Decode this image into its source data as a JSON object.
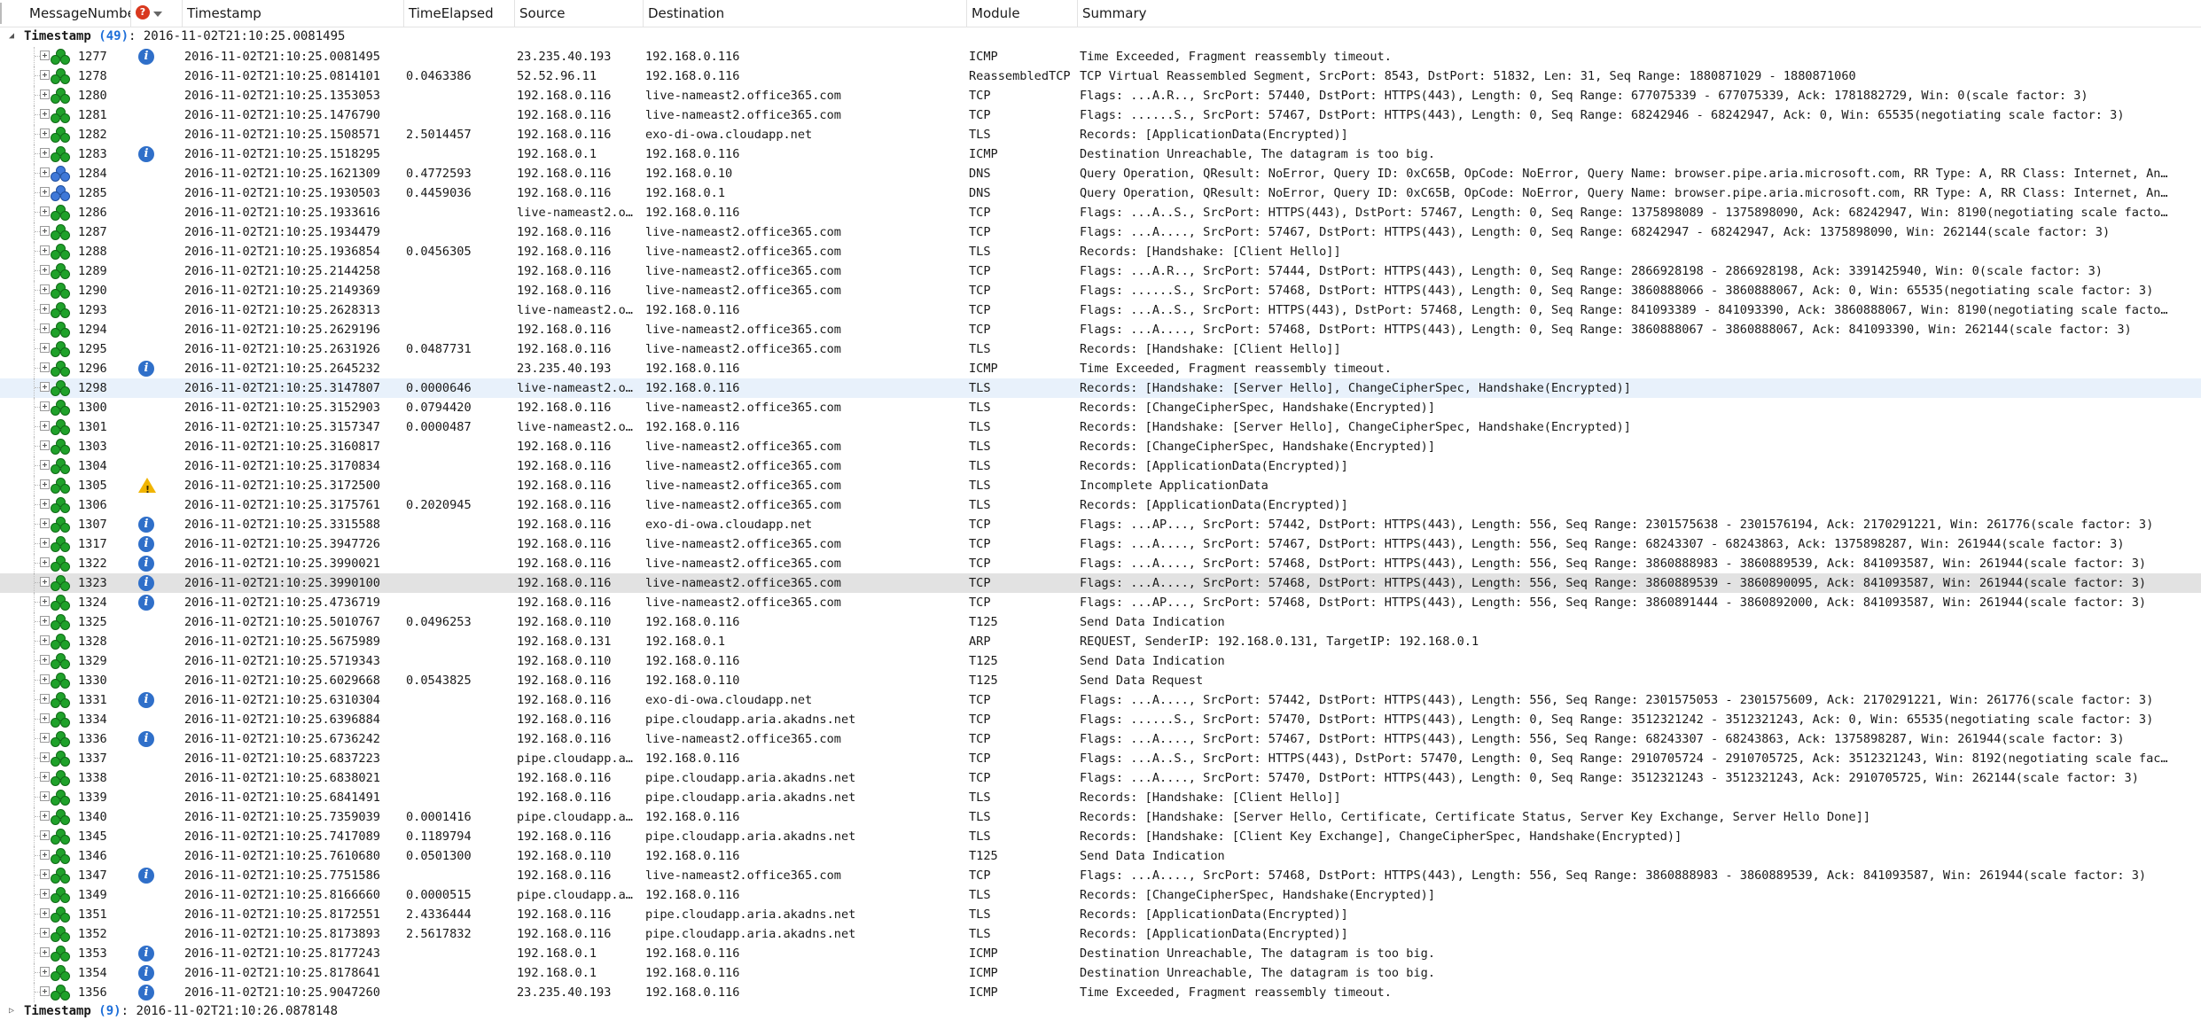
{
  "columns": {
    "message_number": "MessageNumber",
    "timestamp": "Timestamp",
    "time_elapsed": "TimeElapsed",
    "source": "Source",
    "destination": "Destination",
    "module": "Module",
    "summary": "Summary"
  },
  "groups": [
    {
      "label": "Timestamp",
      "count": "(49)",
      "value": ": 2016-11-02T21:10:25.0081495",
      "expanded": true
    },
    {
      "label": "Timestamp",
      "count": "(9)",
      "value": ": 2016-11-02T21:10:26.0878148",
      "expanded": false
    }
  ],
  "rows": [
    {
      "num": "1277",
      "ts": "2016-11-02T21:10:25.0081495",
      "el": "",
      "src": "23.235.40.193",
      "dst": "192.168.0.116",
      "mod": "ICMP",
      "sum": "Time Exceeded, Fragment reassembly timeout.",
      "icon": "green",
      "diag": "info"
    },
    {
      "num": "1278",
      "ts": "2016-11-02T21:10:25.0814101",
      "el": "0.0463386",
      "src": "52.52.96.11",
      "dst": "192.168.0.116",
      "mod": "ReassembledTCP",
      "sum": "TCP Virtual Reassembled Segment, SrcPort: 8543, DstPort: 51832, Len: 31, Seq Range: 1880871029 - 1880871060",
      "icon": "green",
      "diag": ""
    },
    {
      "num": "1280",
      "ts": "2016-11-02T21:10:25.1353053",
      "el": "",
      "src": "192.168.0.116",
      "dst": "live-nameast2.office365.com",
      "mod": "TCP",
      "sum": "Flags: ...A.R.., SrcPort: 57440, DstPort: HTTPS(443), Length: 0, Seq Range: 677075339 - 677075339, Ack: 1781882729, Win: 0(scale factor: 3)",
      "icon": "green",
      "diag": ""
    },
    {
      "num": "1281",
      "ts": "2016-11-02T21:10:25.1476790",
      "el": "",
      "src": "192.168.0.116",
      "dst": "live-nameast2.office365.com",
      "mod": "TCP",
      "sum": "Flags: ......S., SrcPort: 57467, DstPort: HTTPS(443), Length: 0, Seq Range: 68242946 - 68242947, Ack: 0, Win: 65535(negotiating scale factor: 3)",
      "icon": "green",
      "diag": ""
    },
    {
      "num": "1282",
      "ts": "2016-11-02T21:10:25.1508571",
      "el": "2.5014457",
      "src": "192.168.0.116",
      "dst": "exo-di-owa.cloudapp.net",
      "mod": "TLS",
      "sum": "Records: [ApplicationData(Encrypted)]",
      "icon": "green",
      "diag": ""
    },
    {
      "num": "1283",
      "ts": "2016-11-02T21:10:25.1518295",
      "el": "",
      "src": "192.168.0.1",
      "dst": "192.168.0.116",
      "mod": "ICMP",
      "sum": "Destination Unreachable, The datagram is too big.",
      "icon": "green",
      "diag": "info"
    },
    {
      "num": "1284",
      "ts": "2016-11-02T21:10:25.1621309",
      "el": "0.4772593",
      "src": "192.168.0.116",
      "dst": "192.168.0.10",
      "mod": "DNS",
      "sum": "Query Operation, QResult: NoError, Query ID: 0xC65B, OpCode: NoError, Query Name: browser.pipe.aria.microsoft.com, RR Type: A, RR Class: Internet, An…",
      "icon": "blue",
      "diag": ""
    },
    {
      "num": "1285",
      "ts": "2016-11-02T21:10:25.1930503",
      "el": "0.4459036",
      "src": "192.168.0.116",
      "dst": "192.168.0.1",
      "mod": "DNS",
      "sum": "Query Operation, QResult: NoError, Query ID: 0xC65B, OpCode: NoError, Query Name: browser.pipe.aria.microsoft.com, RR Type: A, RR Class: Internet, An…",
      "icon": "blue",
      "diag": ""
    },
    {
      "num": "1286",
      "ts": "2016-11-02T21:10:25.1933616",
      "el": "",
      "src": "live-nameast2.o…",
      "dst": "192.168.0.116",
      "mod": "TCP",
      "sum": "Flags: ...A..S., SrcPort: HTTPS(443), DstPort: 57467, Length: 0, Seq Range: 1375898089 - 1375898090, Ack: 68242947, Win: 8190(negotiating scale facto…",
      "icon": "green",
      "diag": ""
    },
    {
      "num": "1287",
      "ts": "2016-11-02T21:10:25.1934479",
      "el": "",
      "src": "192.168.0.116",
      "dst": "live-nameast2.office365.com",
      "mod": "TCP",
      "sum": "Flags: ...A...., SrcPort: 57467, DstPort: HTTPS(443), Length: 0, Seq Range: 68242947 - 68242947, Ack: 1375898090, Win: 262144(scale factor: 3)",
      "icon": "green",
      "diag": ""
    },
    {
      "num": "1288",
      "ts": "2016-11-02T21:10:25.1936854",
      "el": "0.0456305",
      "src": "192.168.0.116",
      "dst": "live-nameast2.office365.com",
      "mod": "TLS",
      "sum": "Records: [Handshake: [Client Hello]]",
      "icon": "green",
      "diag": ""
    },
    {
      "num": "1289",
      "ts": "2016-11-02T21:10:25.2144258",
      "el": "",
      "src": "192.168.0.116",
      "dst": "live-nameast2.office365.com",
      "mod": "TCP",
      "sum": "Flags: ...A.R.., SrcPort: 57444, DstPort: HTTPS(443), Length: 0, Seq Range: 2866928198 - 2866928198, Ack: 3391425940, Win: 0(scale factor: 3)",
      "icon": "green",
      "diag": ""
    },
    {
      "num": "1290",
      "ts": "2016-11-02T21:10:25.2149369",
      "el": "",
      "src": "192.168.0.116",
      "dst": "live-nameast2.office365.com",
      "mod": "TCP",
      "sum": "Flags: ......S., SrcPort: 57468, DstPort: HTTPS(443), Length: 0, Seq Range: 3860888066 - 3860888067, Ack: 0, Win: 65535(negotiating scale factor: 3)",
      "icon": "green",
      "diag": ""
    },
    {
      "num": "1293",
      "ts": "2016-11-02T21:10:25.2628313",
      "el": "",
      "src": "live-nameast2.o…",
      "dst": "192.168.0.116",
      "mod": "TCP",
      "sum": "Flags: ...A..S., SrcPort: HTTPS(443), DstPort: 57468, Length: 0, Seq Range: 841093389 - 841093390, Ack: 3860888067, Win: 8190(negotiating scale facto…",
      "icon": "green",
      "diag": ""
    },
    {
      "num": "1294",
      "ts": "2016-11-02T21:10:25.2629196",
      "el": "",
      "src": "192.168.0.116",
      "dst": "live-nameast2.office365.com",
      "mod": "TCP",
      "sum": "Flags: ...A...., SrcPort: 57468, DstPort: HTTPS(443), Length: 0, Seq Range: 3860888067 - 3860888067, Ack: 841093390, Win: 262144(scale factor: 3)",
      "icon": "green",
      "diag": ""
    },
    {
      "num": "1295",
      "ts": "2016-11-02T21:10:25.2631926",
      "el": "0.0487731",
      "src": "192.168.0.116",
      "dst": "live-nameast2.office365.com",
      "mod": "TLS",
      "sum": "Records: [Handshake: [Client Hello]]",
      "icon": "green",
      "diag": ""
    },
    {
      "num": "1296",
      "ts": "2016-11-02T21:10:25.2645232",
      "el": "",
      "src": "23.235.40.193",
      "dst": "192.168.0.116",
      "mod": "ICMP",
      "sum": "Time Exceeded, Fragment reassembly timeout.",
      "icon": "green",
      "diag": "info"
    },
    {
      "num": "1298",
      "ts": "2016-11-02T21:10:25.3147807",
      "el": "0.0000646",
      "src": "live-nameast2.o…",
      "dst": "192.168.0.116",
      "mod": "TLS",
      "sum": "Records: [Handshake: [Server Hello], ChangeCipherSpec, Handshake(Encrypted)]",
      "icon": "green",
      "diag": "",
      "state": "sel"
    },
    {
      "num": "1300",
      "ts": "2016-11-02T21:10:25.3152903",
      "el": "0.0794420",
      "src": "192.168.0.116",
      "dst": "live-nameast2.office365.com",
      "mod": "TLS",
      "sum": "Records: [ChangeCipherSpec, Handshake(Encrypted)]",
      "icon": "green",
      "diag": ""
    },
    {
      "num": "1301",
      "ts": "2016-11-02T21:10:25.3157347",
      "el": "0.0000487",
      "src": "live-nameast2.o…",
      "dst": "192.168.0.116",
      "mod": "TLS",
      "sum": "Records: [Handshake: [Server Hello], ChangeCipherSpec, Handshake(Encrypted)]",
      "icon": "green",
      "diag": ""
    },
    {
      "num": "1303",
      "ts": "2016-11-02T21:10:25.3160817",
      "el": "",
      "src": "192.168.0.116",
      "dst": "live-nameast2.office365.com",
      "mod": "TLS",
      "sum": "Records: [ChangeCipherSpec, Handshake(Encrypted)]",
      "icon": "green",
      "diag": ""
    },
    {
      "num": "1304",
      "ts": "2016-11-02T21:10:25.3170834",
      "el": "",
      "src": "192.168.0.116",
      "dst": "live-nameast2.office365.com",
      "mod": "TLS",
      "sum": "Records: [ApplicationData(Encrypted)]",
      "icon": "green",
      "diag": ""
    },
    {
      "num": "1305",
      "ts": "2016-11-02T21:10:25.3172500",
      "el": "",
      "src": "192.168.0.116",
      "dst": "live-nameast2.office365.com",
      "mod": "TLS",
      "sum": "Incomplete ApplicationData",
      "icon": "green",
      "diag": "warn"
    },
    {
      "num": "1306",
      "ts": "2016-11-02T21:10:25.3175761",
      "el": "0.2020945",
      "src": "192.168.0.116",
      "dst": "live-nameast2.office365.com",
      "mod": "TLS",
      "sum": "Records: [ApplicationData(Encrypted)]",
      "icon": "green",
      "diag": ""
    },
    {
      "num": "1307",
      "ts": "2016-11-02T21:10:25.3315588",
      "el": "",
      "src": "192.168.0.116",
      "dst": "exo-di-owa.cloudapp.net",
      "mod": "TCP",
      "sum": "Flags: ...AP..., SrcPort: 57442, DstPort: HTTPS(443), Length: 556, Seq Range: 2301575638 - 2301576194, Ack: 2170291221, Win: 261776(scale factor: 3)",
      "icon": "green",
      "diag": "info"
    },
    {
      "num": "1317",
      "ts": "2016-11-02T21:10:25.3947726",
      "el": "",
      "src": "192.168.0.116",
      "dst": "live-nameast2.office365.com",
      "mod": "TCP",
      "sum": "Flags: ...A...., SrcPort: 57467, DstPort: HTTPS(443), Length: 556, Seq Range: 68243307 - 68243863, Ack: 1375898287, Win: 261944(scale factor: 3)",
      "icon": "green",
      "diag": "info"
    },
    {
      "num": "1322",
      "ts": "2016-11-02T21:10:25.3990021",
      "el": "",
      "src": "192.168.0.116",
      "dst": "live-nameast2.office365.com",
      "mod": "TCP",
      "sum": "Flags: ...A...., SrcPort: 57468, DstPort: HTTPS(443), Length: 556, Seq Range: 3860888983 - 3860889539, Ack: 841093587, Win: 261944(scale factor: 3)",
      "icon": "green",
      "diag": "info"
    },
    {
      "num": "1323",
      "ts": "2016-11-02T21:10:25.3990100",
      "el": "",
      "src": "192.168.0.116",
      "dst": "live-nameast2.office365.com",
      "mod": "TCP",
      "sum": "Flags: ...A...., SrcPort: 57468, DstPort: HTTPS(443), Length: 556, Seq Range: 3860889539 - 3860890095, Ack: 841093587, Win: 261944(scale factor: 3)",
      "icon": "green",
      "diag": "info",
      "state": "hot"
    },
    {
      "num": "1324",
      "ts": "2016-11-02T21:10:25.4736719",
      "el": "",
      "src": "192.168.0.116",
      "dst": "live-nameast2.office365.com",
      "mod": "TCP",
      "sum": "Flags: ...AP..., SrcPort: 57468, DstPort: HTTPS(443), Length: 556, Seq Range: 3860891444 - 3860892000, Ack: 841093587, Win: 261944(scale factor: 3)",
      "icon": "green",
      "diag": "info"
    },
    {
      "num": "1325",
      "ts": "2016-11-02T21:10:25.5010767",
      "el": "0.0496253",
      "src": "192.168.0.110",
      "dst": "192.168.0.116",
      "mod": "T125",
      "sum": "Send Data Indication",
      "icon": "green",
      "diag": ""
    },
    {
      "num": "1328",
      "ts": "2016-11-02T21:10:25.5675989",
      "el": "",
      "src": "192.168.0.131",
      "dst": "192.168.0.1",
      "mod": "ARP",
      "sum": "REQUEST, SenderIP: 192.168.0.131, TargetIP: 192.168.0.1",
      "icon": "green",
      "diag": ""
    },
    {
      "num": "1329",
      "ts": "2016-11-02T21:10:25.5719343",
      "el": "",
      "src": "192.168.0.110",
      "dst": "192.168.0.116",
      "mod": "T125",
      "sum": "Send Data Indication",
      "icon": "green",
      "diag": ""
    },
    {
      "num": "1330",
      "ts": "2016-11-02T21:10:25.6029668",
      "el": "0.0543825",
      "src": "192.168.0.116",
      "dst": "192.168.0.110",
      "mod": "T125",
      "sum": "Send Data Request",
      "icon": "green",
      "diag": ""
    },
    {
      "num": "1331",
      "ts": "2016-11-02T21:10:25.6310304",
      "el": "",
      "src": "192.168.0.116",
      "dst": "exo-di-owa.cloudapp.net",
      "mod": "TCP",
      "sum": "Flags: ...A...., SrcPort: 57442, DstPort: HTTPS(443), Length: 556, Seq Range: 2301575053 - 2301575609, Ack: 2170291221, Win: 261776(scale factor: 3)",
      "icon": "green",
      "diag": "info"
    },
    {
      "num": "1334",
      "ts": "2016-11-02T21:10:25.6396884",
      "el": "",
      "src": "192.168.0.116",
      "dst": "pipe.cloudapp.aria.akadns.net",
      "mod": "TCP",
      "sum": "Flags: ......S., SrcPort: 57470, DstPort: HTTPS(443), Length: 0, Seq Range: 3512321242 - 3512321243, Ack: 0, Win: 65535(negotiating scale factor: 3)",
      "icon": "green",
      "diag": ""
    },
    {
      "num": "1336",
      "ts": "2016-11-02T21:10:25.6736242",
      "el": "",
      "src": "192.168.0.116",
      "dst": "live-nameast2.office365.com",
      "mod": "TCP",
      "sum": "Flags: ...A...., SrcPort: 57467, DstPort: HTTPS(443), Length: 556, Seq Range: 68243307 - 68243863, Ack: 1375898287, Win: 261944(scale factor: 3)",
      "icon": "green",
      "diag": "info"
    },
    {
      "num": "1337",
      "ts": "2016-11-02T21:10:25.6837223",
      "el": "",
      "src": "pipe.cloudapp.a…",
      "dst": "192.168.0.116",
      "mod": "TCP",
      "sum": "Flags: ...A..S., SrcPort: HTTPS(443), DstPort: 57470, Length: 0, Seq Range: 2910705724 - 2910705725, Ack: 3512321243, Win: 8192(negotiating scale fac…",
      "icon": "green",
      "diag": ""
    },
    {
      "num": "1338",
      "ts": "2016-11-02T21:10:25.6838021",
      "el": "",
      "src": "192.168.0.116",
      "dst": "pipe.cloudapp.aria.akadns.net",
      "mod": "TCP",
      "sum": "Flags: ...A...., SrcPort: 57470, DstPort: HTTPS(443), Length: 0, Seq Range: 3512321243 - 3512321243, Ack: 2910705725, Win: 262144(scale factor: 3)",
      "icon": "green",
      "diag": ""
    },
    {
      "num": "1339",
      "ts": "2016-11-02T21:10:25.6841491",
      "el": "",
      "src": "192.168.0.116",
      "dst": "pipe.cloudapp.aria.akadns.net",
      "mod": "TLS",
      "sum": "Records: [Handshake: [Client Hello]]",
      "icon": "green",
      "diag": ""
    },
    {
      "num": "1340",
      "ts": "2016-11-02T21:10:25.7359039",
      "el": "0.0001416",
      "src": "pipe.cloudapp.a…",
      "dst": "192.168.0.116",
      "mod": "TLS",
      "sum": "Records: [Handshake: [Server Hello, Certificate, Certificate Status, Server Key Exchange, Server Hello Done]]",
      "icon": "green",
      "diag": ""
    },
    {
      "num": "1345",
      "ts": "2016-11-02T21:10:25.7417089",
      "el": "0.1189794",
      "src": "192.168.0.116",
      "dst": "pipe.cloudapp.aria.akadns.net",
      "mod": "TLS",
      "sum": "Records: [Handshake: [Client Key Exchange], ChangeCipherSpec, Handshake(Encrypted)]",
      "icon": "green",
      "diag": ""
    },
    {
      "num": "1346",
      "ts": "2016-11-02T21:10:25.7610680",
      "el": "0.0501300",
      "src": "192.168.0.110",
      "dst": "192.168.0.116",
      "mod": "T125",
      "sum": "Send Data Indication",
      "icon": "green",
      "diag": ""
    },
    {
      "num": "1347",
      "ts": "2016-11-02T21:10:25.7751586",
      "el": "",
      "src": "192.168.0.116",
      "dst": "live-nameast2.office365.com",
      "mod": "TCP",
      "sum": "Flags: ...A...., SrcPort: 57468, DstPort: HTTPS(443), Length: 556, Seq Range: 3860888983 - 3860889539, Ack: 841093587, Win: 261944(scale factor: 3)",
      "icon": "green",
      "diag": "info"
    },
    {
      "num": "1349",
      "ts": "2016-11-02T21:10:25.8166660",
      "el": "0.0000515",
      "src": "pipe.cloudapp.a…",
      "dst": "192.168.0.116",
      "mod": "TLS",
      "sum": "Records: [ChangeCipherSpec, Handshake(Encrypted)]",
      "icon": "green",
      "diag": ""
    },
    {
      "num": "1351",
      "ts": "2016-11-02T21:10:25.8172551",
      "el": "2.4336444",
      "src": "192.168.0.116",
      "dst": "pipe.cloudapp.aria.akadns.net",
      "mod": "TLS",
      "sum": "Records: [ApplicationData(Encrypted)]",
      "icon": "green",
      "diag": ""
    },
    {
      "num": "1352",
      "ts": "2016-11-02T21:10:25.8173893",
      "el": "2.5617832",
      "src": "192.168.0.116",
      "dst": "pipe.cloudapp.aria.akadns.net",
      "mod": "TLS",
      "sum": "Records: [ApplicationData(Encrypted)]",
      "icon": "green",
      "diag": ""
    },
    {
      "num": "1353",
      "ts": "2016-11-02T21:10:25.8177243",
      "el": "",
      "src": "192.168.0.1",
      "dst": "192.168.0.116",
      "mod": "ICMP",
      "sum": "Destination Unreachable, The datagram is too big.",
      "icon": "green",
      "diag": "info"
    },
    {
      "num": "1354",
      "ts": "2016-11-02T21:10:25.8178641",
      "el": "",
      "src": "192.168.0.1",
      "dst": "192.168.0.116",
      "mod": "ICMP",
      "sum": "Destination Unreachable, The datagram is too big.",
      "icon": "green",
      "diag": "info"
    },
    {
      "num": "1356",
      "ts": "2016-11-02T21:10:25.9047260",
      "el": "",
      "src": "23.235.40.193",
      "dst": "192.168.0.116",
      "mod": "ICMP",
      "sum": "Time Exceeded, Fragment reassembly timeout.",
      "icon": "green",
      "diag": "info"
    }
  ]
}
